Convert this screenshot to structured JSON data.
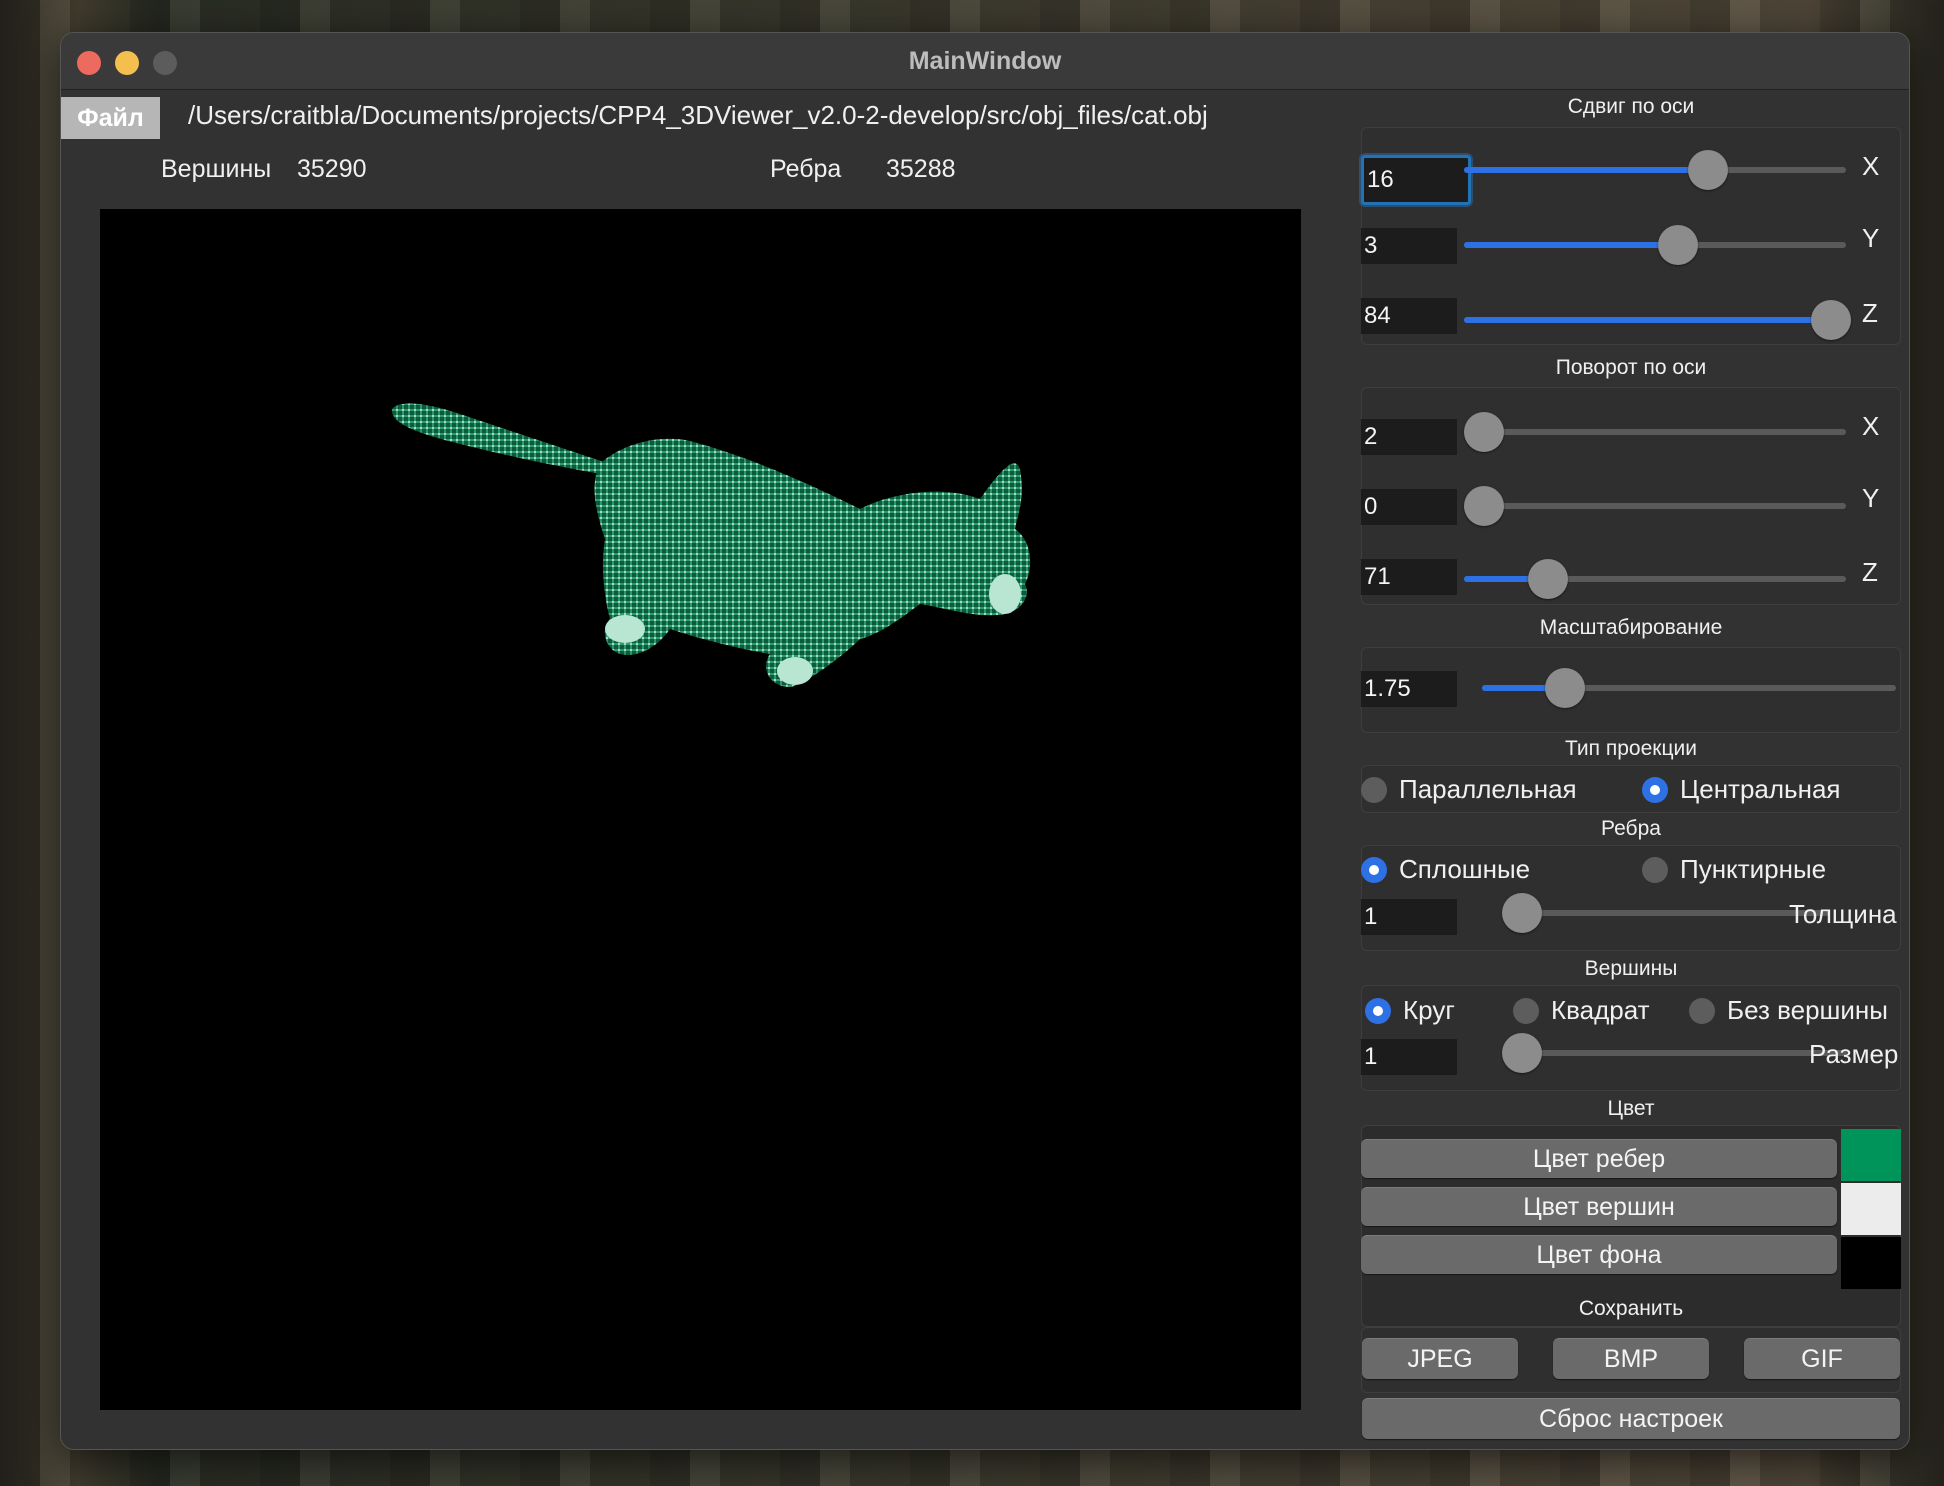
{
  "window": {
    "title": "MainWindow"
  },
  "menu": {
    "file": "Файл"
  },
  "file_path": "/Users/craitbla/Documents/projects/CPP4_3DViewer_v2.0-2-develop/src/obj_files/cat.obj",
  "stats": {
    "vertices_label": "Вершины",
    "vertices_value": "35290",
    "edges_label": "Ребра",
    "edges_value": "35288"
  },
  "translate": {
    "title": "Сдвиг по оси",
    "x": {
      "value": "16",
      "label": "X",
      "level": 0.64
    },
    "y": {
      "value": "3",
      "label": "Y",
      "level": 0.56
    },
    "z": {
      "value": "84",
      "label": "Z",
      "level": 0.96
    }
  },
  "rotate": {
    "title": "Поворот по оси",
    "x": {
      "value": "2",
      "label": "X",
      "level": 0.05
    },
    "y": {
      "value": "0",
      "label": "Y",
      "level": 0.0
    },
    "z": {
      "value": "71",
      "label": "Z",
      "level": 0.22
    }
  },
  "scale": {
    "title": "Масштабирование",
    "value": "1.75",
    "level": 0.2
  },
  "projection": {
    "title": "Тип проекции",
    "parallel": "Параллельная",
    "central": "Центральная",
    "selected": "central"
  },
  "edges": {
    "title": "Ребра",
    "solid": "Сплошные",
    "dashed": "Пунктирные",
    "selected": "solid",
    "thickness_value": "1",
    "thickness_label": "Толщина",
    "thickness_level": 0.0
  },
  "vertices": {
    "title": "Вершины",
    "circle": "Круг",
    "square": "Квадрат",
    "none": "Без вершины",
    "selected": "circle",
    "size_value": "1",
    "size_label": "Размер",
    "size_level": 0.0
  },
  "colors": {
    "title": "Цвет",
    "edge_button": "Цвет ребер",
    "vertex_button": "Цвет вершин",
    "background_button": "Цвет фона",
    "edge_color": "#00935a",
    "vertex_color": "#ececec",
    "background_color": "#000000"
  },
  "save": {
    "title": "Сохранить",
    "jpeg": "JPEG",
    "bmp": "BMP",
    "gif": "GIF",
    "reset": "Сброс настроек"
  }
}
